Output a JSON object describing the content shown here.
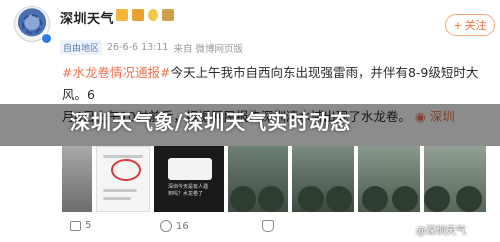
{
  "account": {
    "name": "深圳天气",
    "source_tag": "自由地区",
    "timestamp": "26-6-6 13:11",
    "via": "来自 微博网页版"
  },
  "follow_button": {
    "label": "关注",
    "prefix": "+"
  },
  "post": {
    "hashtag": "#水龙卷情况通报#",
    "line1_rest": "今天上午我市自西向东出现强雷雨，并伴有8-9级短时大风。6",
    "line2": "月6日上午10时前后，根据网民报告深圳湾水域出现了水龙卷。",
    "link_label": "深圳"
  },
  "banner": {
    "title": "深圳天气象/深圳天气实时动态"
  },
  "media_chat": {
    "text": "深圳今天是有人遇到吗？水龙卷了"
  },
  "actions": {
    "share_count": "5",
    "comment_count": "16",
    "like_count": ""
  },
  "watermark": "@深圳天气",
  "colors": {
    "accent": "#eb7350",
    "banner_bg": "#000000",
    "follow_border": "#f3a77d"
  },
  "icons": [
    "share-icon",
    "comment-icon",
    "like-icon",
    "verified-icon"
  ]
}
